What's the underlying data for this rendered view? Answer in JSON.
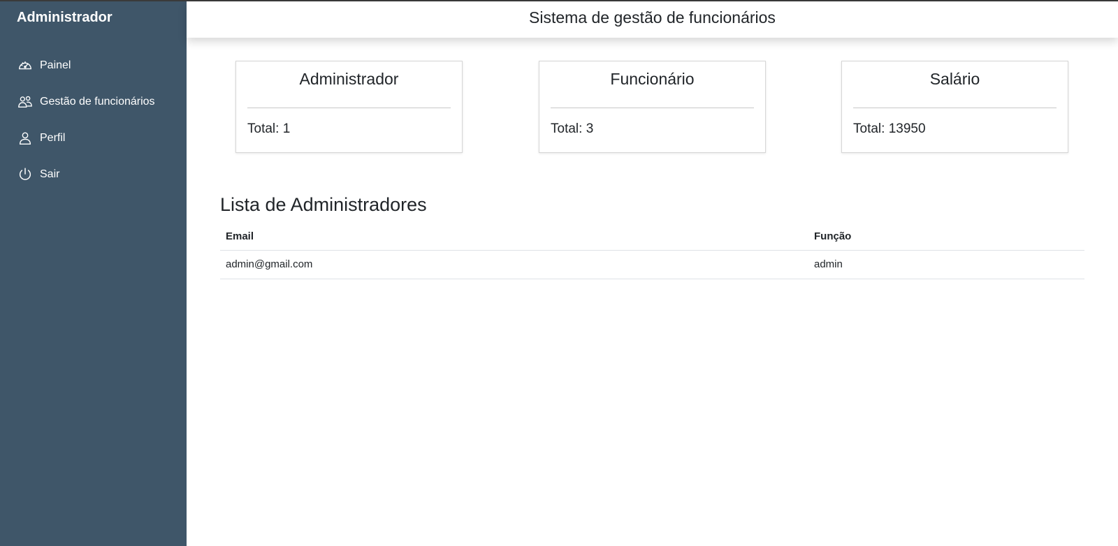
{
  "sidebar": {
    "brand": "Administrador",
    "background_color": "#3f5669",
    "items": [
      {
        "label": "Painel",
        "icon": "speedometer-icon"
      },
      {
        "label": "Gestão de funcionários",
        "icon": "people-icon"
      },
      {
        "label": "Perfil",
        "icon": "person-icon"
      },
      {
        "label": "Sair",
        "icon": "power-icon"
      }
    ]
  },
  "header": {
    "title": "Sistema de gestão de funcionários"
  },
  "cards": [
    {
      "title": "Administrador",
      "total": "Total: 1"
    },
    {
      "title": "Funcionário",
      "total": "Total: 3"
    },
    {
      "title": "Salário",
      "total": "Total: 13950"
    }
  ],
  "admin_list": {
    "title": "Lista de Administradores",
    "columns": [
      "Email",
      "Função"
    ],
    "rows": [
      {
        "email": "admin@gmail.com",
        "role": "admin"
      }
    ]
  }
}
